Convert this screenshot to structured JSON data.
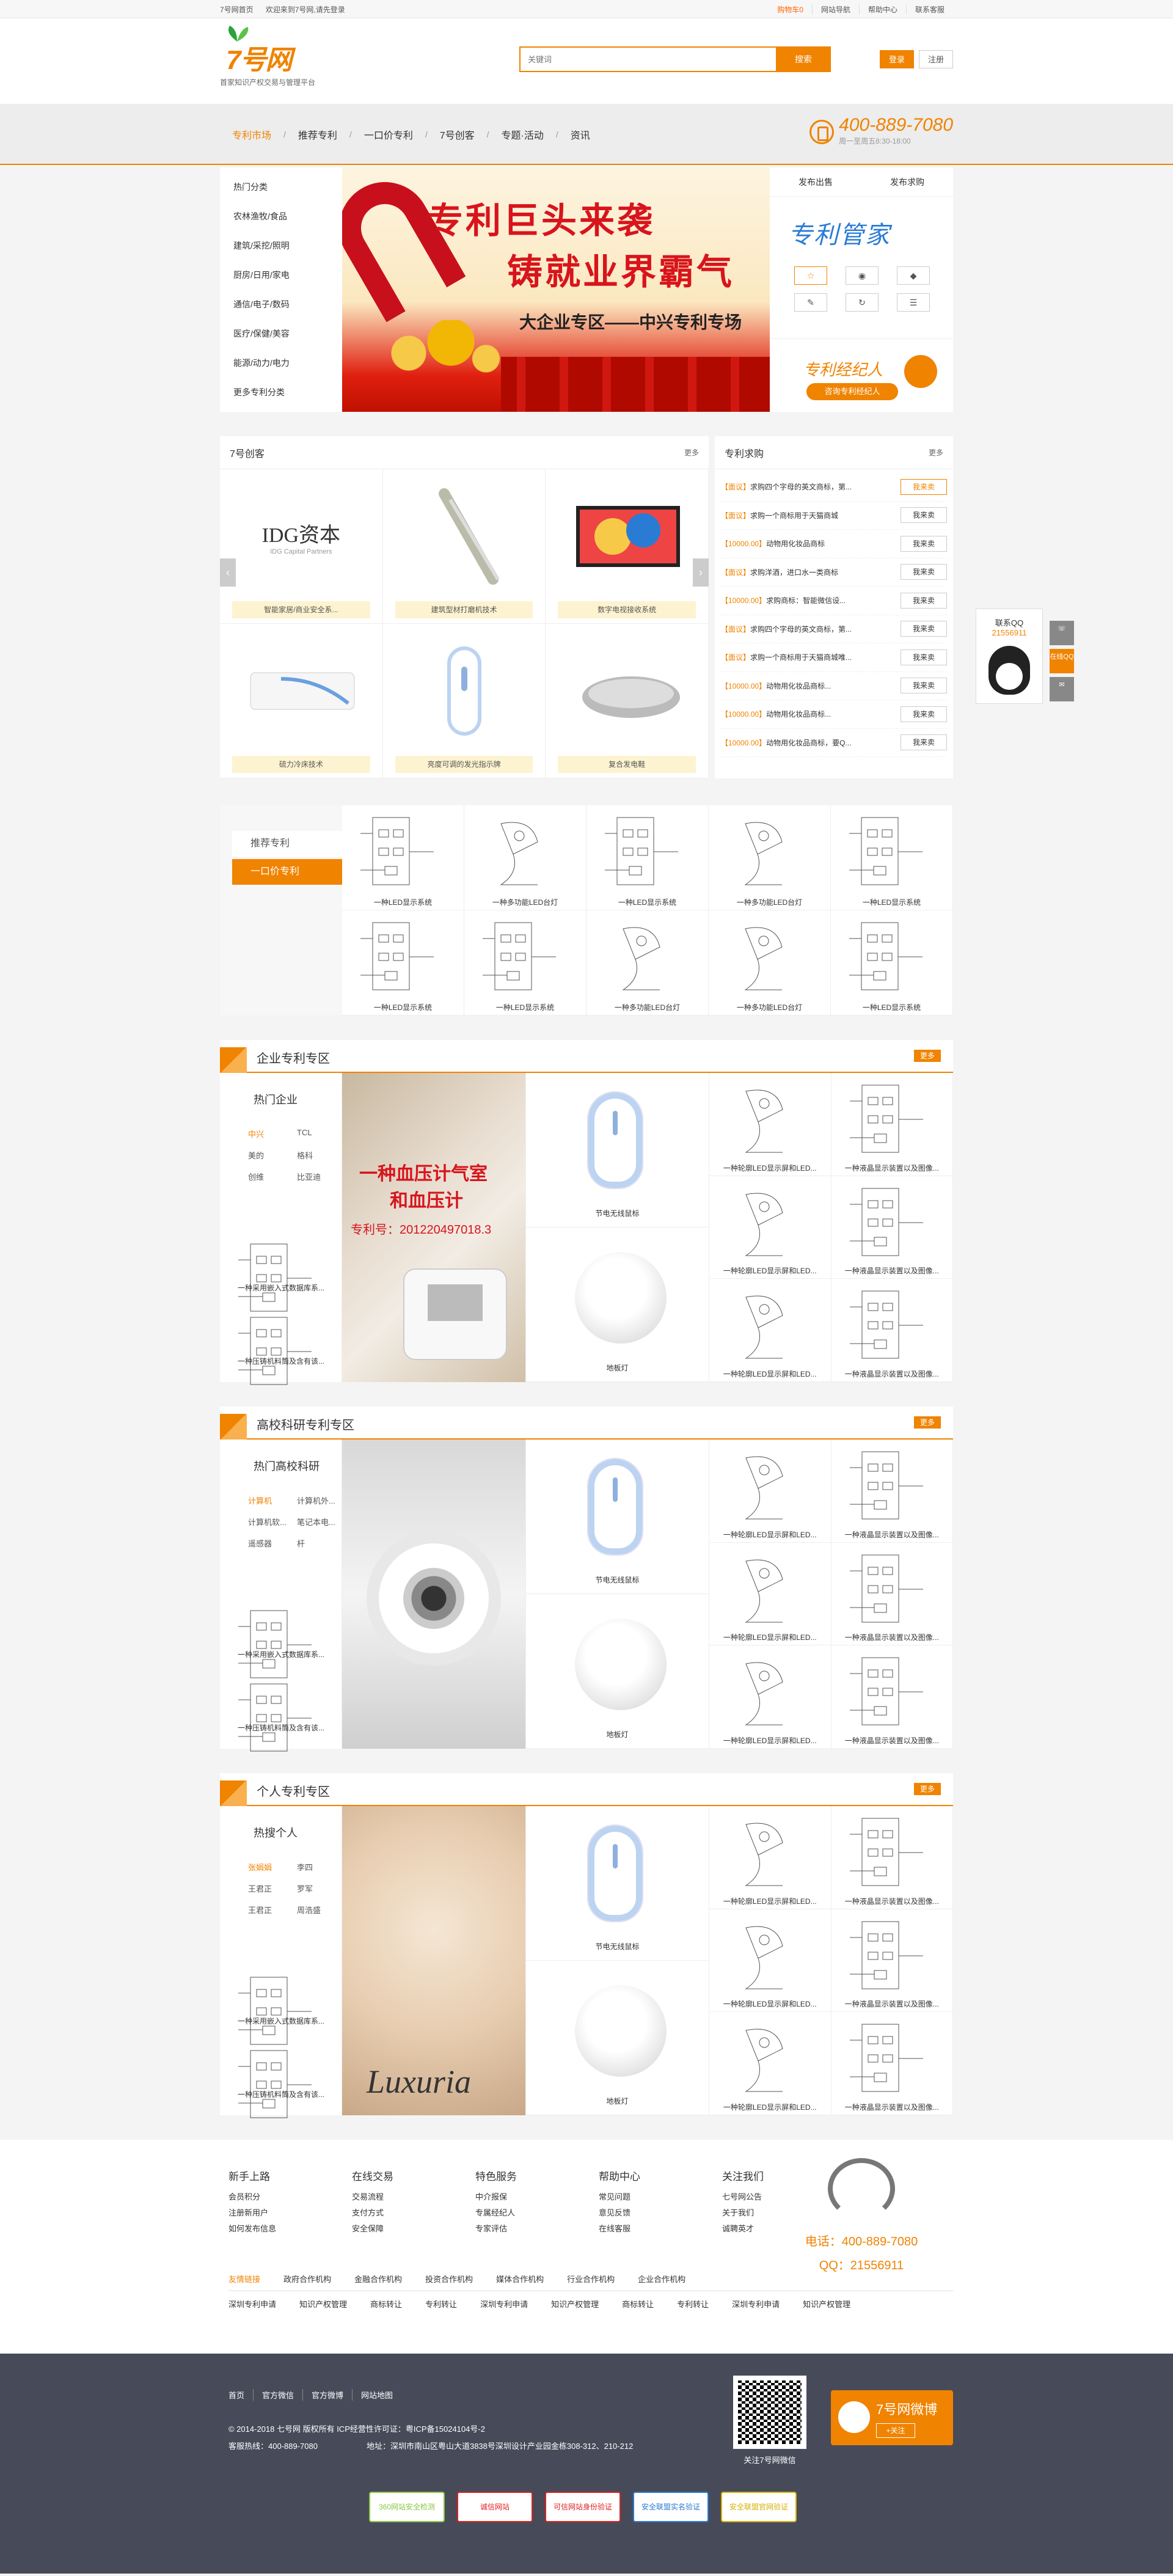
{
  "topbar": {
    "home": "7号网首页",
    "welcome": "欢迎来到7号网,请先登录",
    "cart": "购物车0",
    "links": [
      "网站导航",
      "帮助中心",
      "联系客服"
    ]
  },
  "header": {
    "logo": "7号网",
    "tagline": "首家知识产权交易与管理平台",
    "search_placeholder": "关键词",
    "search_button": "搜索",
    "login": "登录",
    "register": "注册"
  },
  "nav": {
    "items": [
      "专利市场",
      "推荐专利",
      "一口价专利",
      "7号创客",
      "专题·活动",
      "资讯"
    ],
    "phone": "400-889-7080",
    "hours": "周一至周五8:30-18:00"
  },
  "categories": [
    "热门分类",
    "农林渔牧/食品",
    "建筑/采挖/照明",
    "厨房/日用/家电",
    "通信/电子/数码",
    "医疗/保健/美容",
    "能源/动力/电力",
    "更多专利分类"
  ],
  "banner": {
    "line1": "专利巨头来袭",
    "line2": "铸就业界霸气",
    "line3": "大企业专区——中兴专利专场"
  },
  "side_panel": {
    "tabs": [
      "发布出售",
      "发布求购"
    ],
    "title": "专利管家",
    "icons": [
      "star-icon",
      "eye-icon",
      "tag-icon",
      "pencil-icon",
      "refresh-icon",
      "list-icon"
    ],
    "broker_title": "专利经纪人",
    "broker_button": "咨询专利经纪人"
  },
  "creative": {
    "title": "7号创客",
    "more": "更多",
    "idg": "IDG资本",
    "idg_sub": "IDG Capital Partners",
    "items": [
      "智能家居/商业安全系...",
      "建筑型材打磨机技术",
      "数字电视接收系统",
      "硫力冷床技术",
      "亮度可调的发光指示牌",
      "复合发电鞋"
    ]
  },
  "demand": {
    "title": "专利求购",
    "more": "更多",
    "rows": [
      {
        "tag": "【面议】",
        "text": "求购四个字母的英文商标，第...",
        "btn": "我来卖",
        "hot": true
      },
      {
        "tag": "【面议】",
        "text": "求购一个商标用于天猫商城",
        "btn": "我来卖",
        "hot": false
      },
      {
        "tag": "【10000.00】",
        "text": "动物用化妆品商标",
        "btn": "我来卖",
        "hot": false
      },
      {
        "tag": "【面议】",
        "text": "求购洋酒，进口水一类商标",
        "btn": "我来卖",
        "hot": false
      },
      {
        "tag": "【10000.00】",
        "text": "求购商标：智能微信设...",
        "btn": "我来卖",
        "hot": false
      },
      {
        "tag": "【面议】",
        "text": "求购四个字母的英文商标，第...",
        "btn": "我来卖",
        "hot": false
      },
      {
        "tag": "【面议】",
        "text": "求购一个商标用于天猫商城唯...",
        "btn": "我来卖",
        "hot": false
      },
      {
        "tag": "【10000.00】",
        "text": "动物用化妆品商标...",
        "btn": "我来卖",
        "hot": false
      },
      {
        "tag": "【10000.00】",
        "text": "动物用化妆品商标...",
        "btn": "我来卖",
        "hot": false
      },
      {
        "tag": "【10000.00】",
        "text": "动物用化妆品商标，要Q...",
        "btn": "我来卖",
        "hot": false
      }
    ]
  },
  "recommend": {
    "menu": [
      "推荐专利",
      "一口价专利"
    ],
    "items": [
      "一种LED显示系统",
      "一种多功能LED台灯",
      "一种LED显示系统",
      "一种多功能LED台灯",
      "一种LED显示系统",
      "一种LED显示系统",
      "一种LED显示系统",
      "一种多功能LED台灯",
      "一种多功能LED台灯",
      "一种LED显示系统"
    ]
  },
  "zones": [
    {
      "title": "企业专利专区",
      "more": "更多",
      "hot_title": "热门企业",
      "hot": [
        "中兴",
        "TCL",
        "美的",
        "格科",
        "创维",
        "比亚迪"
      ],
      "items": [
        "一种采用嵌入式数据库系...",
        "一种压铸机料筒及含有该..."
      ],
      "big_text1": "一种血压计气室",
      "big_text2": "和血压计",
      "big_text3": "专利号：201220497018.3",
      "products": [
        "节电无线鼠标",
        "地板灯"
      ],
      "list": [
        "一种轮廓LED显示屏和LED...",
        "一种液晶显示装置以及图像...",
        "一种轮廓LED显示屏和LED...",
        "一种液晶显示装置以及图像...",
        "一种轮廓LED显示屏和LED...",
        "一种液晶显示装置以及图像..."
      ]
    },
    {
      "title": "高校科研专利专区",
      "more": "更多",
      "hot_title": "热门高校科研",
      "hot": [
        "计算机",
        "计算机外...",
        "计算机软...",
        "笔记本电...",
        "遥感器",
        "杆"
      ],
      "items": [
        "一种采用嵌入式数据库系...",
        "一种压铸机料筒及含有该..."
      ],
      "big_text1": "",
      "big_text2": "",
      "big_text3": "",
      "products": [
        "节电无线鼠标",
        "地板灯"
      ],
      "list": [
        "一种轮廓LED显示屏和LED...",
        "一种液晶显示装置以及图像...",
        "一种轮廓LED显示屏和LED...",
        "一种液晶显示装置以及图像...",
        "一种轮廓LED显示屏和LED...",
        "一种液晶显示装置以及图像..."
      ]
    },
    {
      "title": "个人专利专区",
      "more": "更多",
      "hot_title": "热搜个人",
      "hot": [
        "张娟娟",
        "李四",
        "王君正",
        "罗军",
        "王君正",
        "周浩盛"
      ],
      "items": [
        "一种采用嵌入式数据库系...",
        "一种压铸机料筒及含有该..."
      ],
      "big_text1": "",
      "big_text2": "",
      "big_text3": "Luxuria",
      "products": [
        "节电无线鼠标",
        "地板灯"
      ],
      "list": [
        "一种轮廓LED显示屏和LED...",
        "一种液晶显示装置以及图像...",
        "一种轮廓LED显示屏和LED...",
        "一种液晶显示装置以及图像...",
        "一种轮廓LED显示屏和LED...",
        "一种液晶显示装置以及图像..."
      ]
    }
  ],
  "footer": {
    "cols": [
      {
        "h": "新手上路",
        "l": [
          "会员积分",
          "注册新用户",
          "如何发布信息"
        ]
      },
      {
        "h": "在线交易",
        "l": [
          "交易流程",
          "支付方式",
          "安全保障"
        ]
      },
      {
        "h": "特色服务",
        "l": [
          "中介报保",
          "专属经纪人",
          "专家评估"
        ]
      },
      {
        "h": "帮助中心",
        "l": [
          "常见问题",
          "意见反馈",
          "在线客服"
        ]
      },
      {
        "h": "关注我们",
        "l": [
          "七号网公告",
          "关于我们",
          "诚聘英才"
        ]
      }
    ],
    "tel": "电话：400-889-7080",
    "qq": "QQ：21556911",
    "tabs": [
      "友情链接",
      "政府合作机构",
      "金融合作机构",
      "投资合作机构",
      "媒体合作机构",
      "行业合作机构",
      "企业合作机构"
    ],
    "links": [
      "深圳专利申请",
      "知识产权管理",
      "商标转让",
      "专利转让",
      "深圳专利申请",
      "知识产权管理",
      "商标转让",
      "专利转让",
      "深圳专利申请",
      "知识产权管理"
    ],
    "nav": [
      "首页",
      "官方微信",
      "官方微博",
      "网站地图"
    ],
    "copy1": "© 2014-2018 七号网 版权所有 ICP经营性许可证：粤ICP备15024104号-2",
    "copy2": "客服热线：400-889-7080",
    "copy3": "地址：深圳市南山区粤山大道3838号深圳设计产业园金栋308-312、210-212",
    "qr_label": "关注7号网微信",
    "weibo": "7号网微博",
    "follow": "+关注",
    "badges": [
      "360网站安全检测",
      "诚信网站",
      "可信网站身份验证",
      "安全联盟实名验证",
      "安全联盟官网验证"
    ]
  },
  "float": {
    "title": "联系QQ",
    "number": "21556911",
    "side": [
      "",
      "在线QQ",
      ""
    ]
  }
}
